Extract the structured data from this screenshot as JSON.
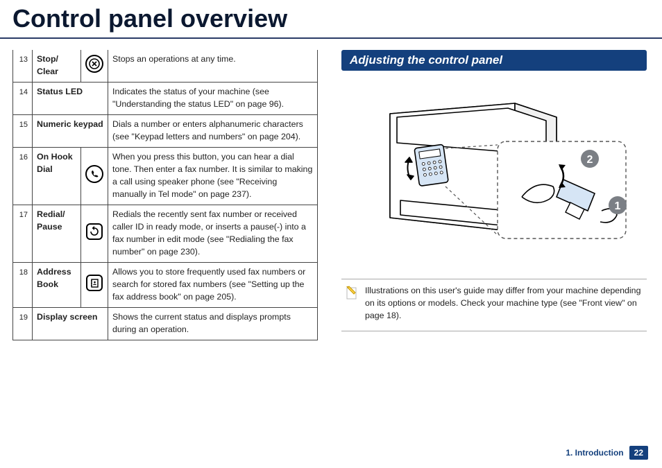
{
  "title": "Control panel overview",
  "table": [
    {
      "num": "13",
      "name": "Stop/ Clear",
      "icon": "stop-clear-icon",
      "desc": "Stops an operations at any time."
    },
    {
      "num": "14",
      "name": "Status LED",
      "icon": "",
      "desc": "Indicates the status of your machine (see \"Understanding the status LED\" on page 96)."
    },
    {
      "num": "15",
      "name": "Numeric keypad",
      "icon": "",
      "desc": "Dials a number or enters alphanumeric characters (see \"Keypad letters and numbers\" on page 204)."
    },
    {
      "num": "16",
      "name": "On Hook Dial",
      "icon": "on-hook-dial-icon",
      "desc": "When you press this button, you can hear a dial tone. Then enter a fax number. It is similar to making a call using speaker phone (see \"Receiving manually in Tel mode\" on page 237)."
    },
    {
      "num": "17",
      "name": "Redial/ Pause",
      "icon": "redial-pause-icon",
      "desc": "Redials the recently sent fax number or received caller ID in ready mode, or inserts a pause(-) into a fax number in edit mode (see \"Redialing the fax number\" on page 230)."
    },
    {
      "num": "18",
      "name": "Address Book",
      "icon": "address-book-icon",
      "desc": "Allows you to store frequently used fax numbers or search for stored fax numbers (see \"Setting up the fax address book\" on page 205)."
    },
    {
      "num": "19",
      "name": "Display screen",
      "icon": "",
      "desc": "Shows the current status and displays prompts during an operation."
    }
  ],
  "section_header": "Adjusting the control panel",
  "callouts": {
    "one": "1",
    "two": "2"
  },
  "note": "Illustrations on this user's guide may differ from your machine depending on its options or models. Check your machine type (see \"Front view\" on page 18).",
  "footer": {
    "chapter": "1. Introduction",
    "page": "22"
  }
}
